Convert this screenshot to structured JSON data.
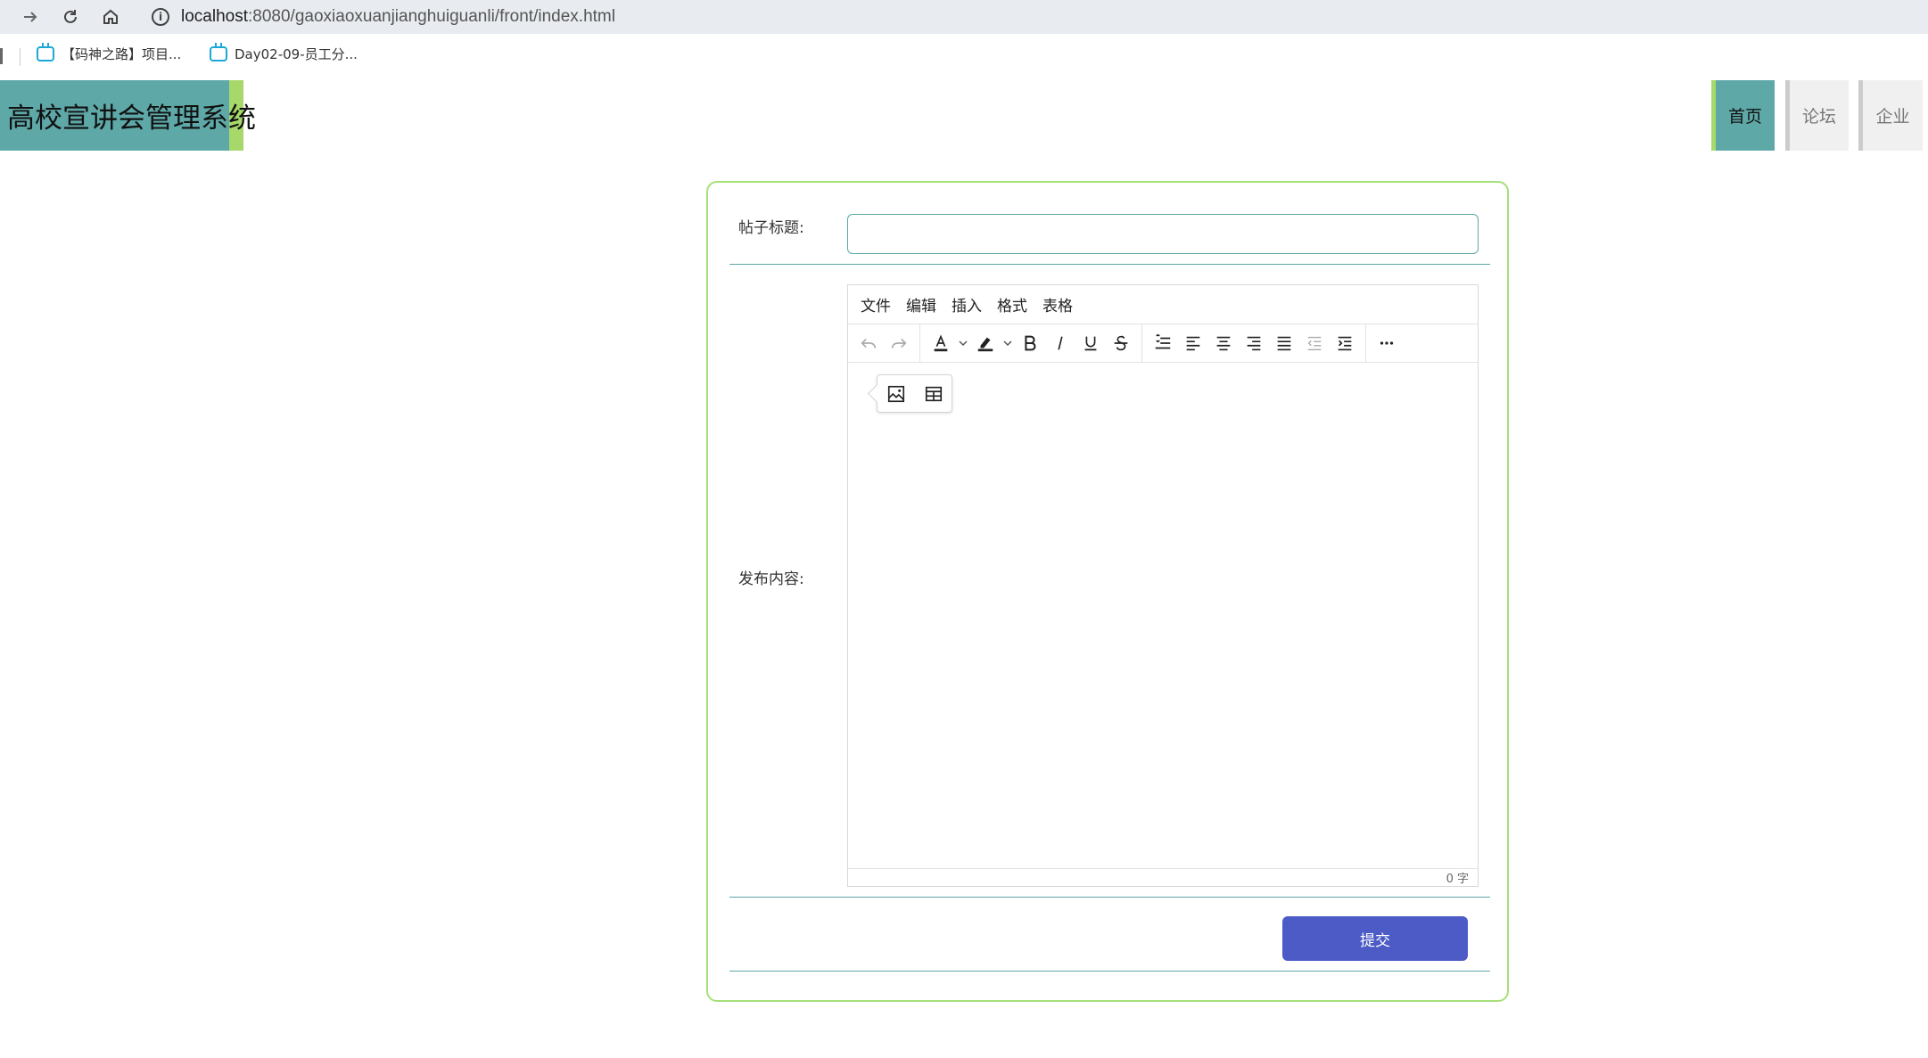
{
  "browser": {
    "url_host": "localhost",
    "url_rest": ":8080/gaoxiaoxuanjianghuiguanli/front/index.html",
    "bookmarks": [
      {
        "label": "【码神之路】项目..."
      },
      {
        "label": "Day02-09-员工分..."
      }
    ]
  },
  "site": {
    "title": "高校宣讲会管理系统",
    "nav": [
      {
        "label": "首页",
        "active": true
      },
      {
        "label": "论坛",
        "active": false
      },
      {
        "label": "企业",
        "active": false
      }
    ],
    "accent_color": "#5ea8a7",
    "highlight_color": "#a6d96a"
  },
  "form": {
    "title_label": "帖子标题:",
    "title_value": "",
    "content_label": "发布内容:",
    "submit_label": "提交",
    "submit_color": "#4c5bc6"
  },
  "editor": {
    "menus": [
      "文件",
      "编辑",
      "插入",
      "格式",
      "表格"
    ],
    "word_count": "0 字",
    "toolbar_icons": [
      "undo-icon",
      "redo-icon",
      "text-color-icon",
      "highlight-icon",
      "bold-icon",
      "italic-icon",
      "underline-icon",
      "strikethrough-icon",
      "line-height-icon",
      "align-left-icon",
      "align-center-icon",
      "align-right-icon",
      "align-justify-icon",
      "outdent-icon",
      "indent-icon",
      "more-icon"
    ],
    "quick_insert_icons": [
      "image-icon",
      "table-icon"
    ]
  }
}
